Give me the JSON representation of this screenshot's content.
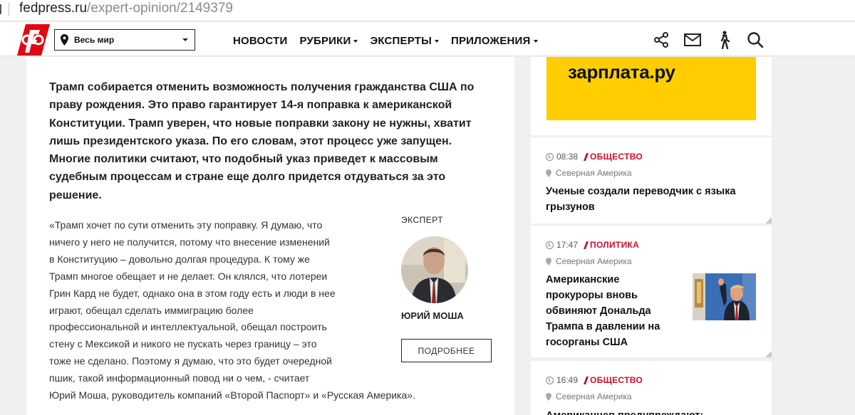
{
  "browser": {
    "url_host": "fedpress.ru",
    "url_path": "/expert-opinion/2149379"
  },
  "header": {
    "logo_icon": "fedpress-logo-icon",
    "region": "Весь мир",
    "nav": [
      {
        "label": "НОВОСТИ",
        "dropdown": false
      },
      {
        "label": "РУБРИКИ",
        "dropdown": true
      },
      {
        "label": "ЭКСПЕРТЫ",
        "dropdown": true
      },
      {
        "label": "ПРИЛОЖЕНИЯ",
        "dropdown": true
      }
    ],
    "icons": [
      "share-icon",
      "mail-icon",
      "walking-person-icon",
      "search-icon"
    ],
    "brand_color": "#e30613"
  },
  "article": {
    "lead_lines": [
      "Трамп собирается отменить возможность получения гражданства США по",
      "праву рождения. Это право гарантирует 14-я поправка к американской",
      "Конституции. Трамп уверен, что новые поправки закону не нужны, хватит",
      "лишь президентского указа. По его словам, этот процесс уже запущен.",
      "Многие политики считают, что подобный указ приведет к массовым",
      "судебным процессам и стране еще долго придется отдуваться за это",
      "решение."
    ],
    "quote_lines": [
      "«Трамп хочет по сути отменить эту поправку. Я думаю, что",
      "ничего у него не получится, потому что внесение изменений",
      "в Конституцию – довольно долгая процедура. К тому же",
      "Трамп многое обещает и не делает. Он клялся, что лотереи",
      "Грин Кард не будет, однако она в этом году есть и люди в нее",
      "играют, обещал сделать иммиграцию более",
      "профессиональной и интеллектуальной, обещал построить",
      "стену с Мексикой и никого не пускать через границу – это",
      "тоже не сделано. Поэтому я думаю, что это будет очередной",
      "пшик, такой информационный повод ни о чем, - считает",
      "Юрий Моша, руководитель компаний «Второй Паспорт» и «Русская Америка»."
    ],
    "expert": {
      "label": "ЭКСПЕРТ",
      "name": "ЮРИЙ МОША",
      "button": "ПОДРОБНЕЕ"
    }
  },
  "sidebar": {
    "ad": {
      "text": "зарплата.ру",
      "bg_color": "#ffcd00"
    },
    "news": [
      {
        "time": "08:38",
        "category": "ОБЩЕСТВО",
        "location": "Северная Америка",
        "title_lines": [
          "Ученые создали переводчик с языка",
          "грызунов"
        ],
        "has_image": false
      },
      {
        "time": "17:47",
        "category": "ПОЛИТИКА",
        "location": "Северная Америка",
        "title_lines": [
          "Американские",
          "прокуроры вновь",
          "обвиняют Дональда",
          "Трампа в давлении на",
          "госорганы США"
        ],
        "has_image": true
      },
      {
        "time": "16:49",
        "category": "ОБЩЕСТВО",
        "location": "Северная Америка",
        "title_lines": [
          "Американцев предупреждают:"
        ],
        "has_image": false
      }
    ],
    "category_color": "#c8102e"
  }
}
